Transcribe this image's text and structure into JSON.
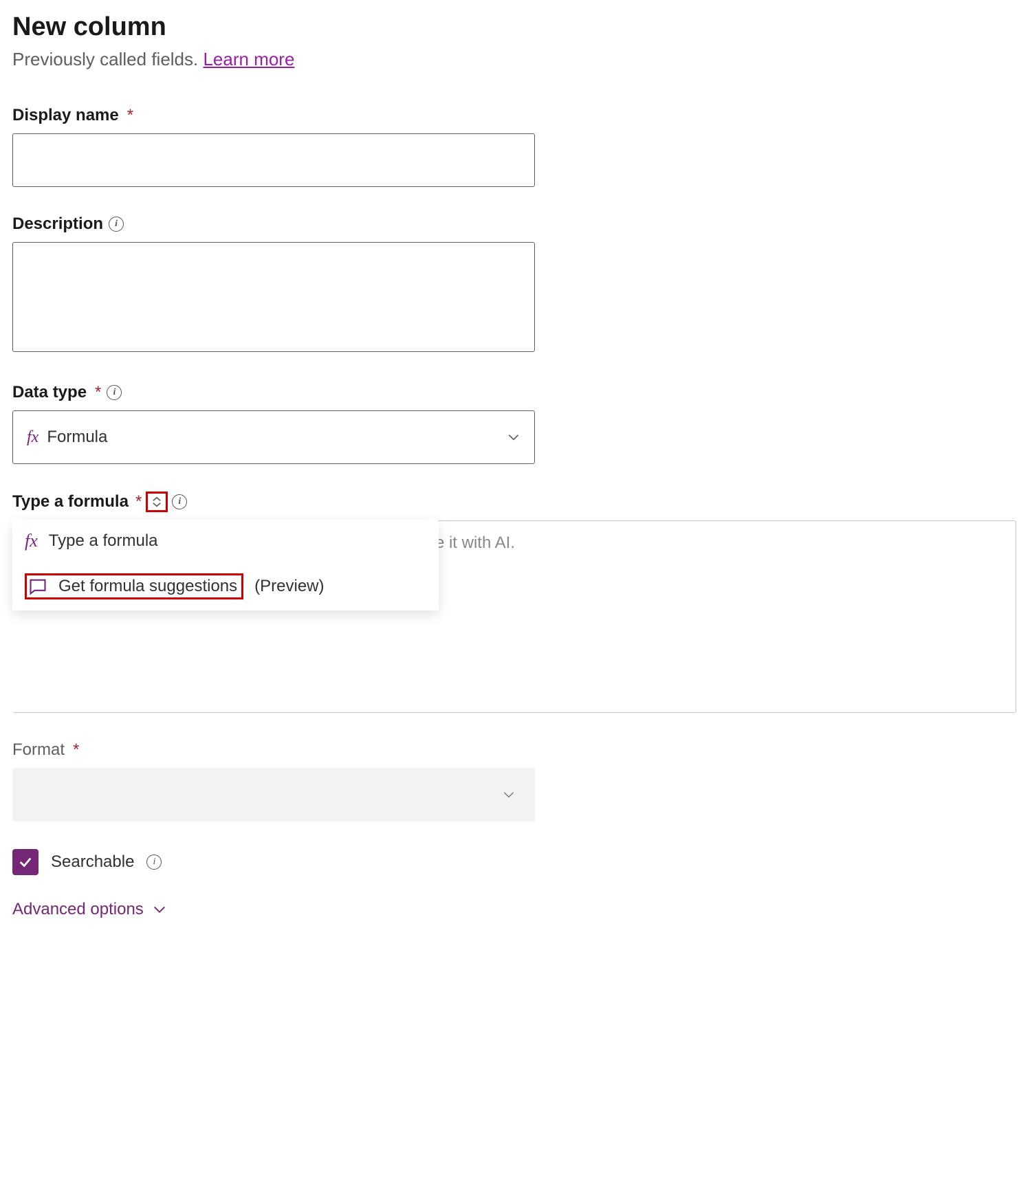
{
  "header": {
    "title": "New column",
    "subtitle_prefix": "Previously called fields. ",
    "learn_more": "Learn more"
  },
  "fields": {
    "display_name": {
      "label": "Display name",
      "value": ""
    },
    "description": {
      "label": "Description",
      "value": ""
    },
    "data_type": {
      "label": "Data type",
      "selected": "Formula"
    },
    "formula": {
      "label": "Type a formula",
      "placeholder": "menu to create it with AI."
    },
    "format": {
      "label": "Format",
      "selected": ""
    },
    "searchable": {
      "label": "Searchable",
      "checked": true
    }
  },
  "dropdown": {
    "type_formula": "Type a formula",
    "get_suggestions": "Get formula suggestions",
    "preview": "(Preview)"
  },
  "advanced": {
    "label": "Advanced options"
  },
  "icons": {
    "info_glyph": "i"
  }
}
